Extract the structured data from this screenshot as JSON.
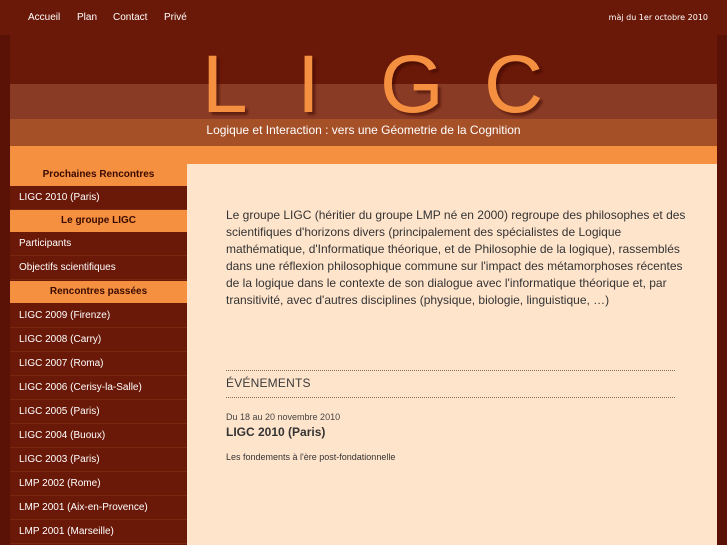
{
  "topnav": {
    "links": [
      "Accueil",
      "Plan",
      "Contact",
      "Privé"
    ],
    "updated": "màj du 1er octobre 2010"
  },
  "banner": {
    "logo_letters": [
      "L",
      "I",
      "G",
      "C"
    ],
    "tagline": "Logique et Interaction : vers une Géometrie de la Cognition"
  },
  "sidebar": {
    "sections": [
      {
        "heading": "Prochaines Rencontres",
        "items": [
          "LIGC 2010 (Paris)"
        ]
      },
      {
        "heading": "Le groupe LIGC",
        "items": [
          "Participants",
          "Objectifs scientifiques"
        ]
      },
      {
        "heading": "Rencontres passées",
        "items": [
          "LIGC 2009 (Firenze)",
          "LIGC 2008 (Carry)",
          "LIGC 2007 (Roma)",
          "LIGC 2006 (Cerisy-la-Salle)",
          "LIGC 2005 (Paris)",
          "LIGC 2004 (Buoux)",
          "LIGC 2003 (Paris)",
          "LMP 2002 (Rome)",
          "LMP 2001 (Aix-en-Provence)",
          "LMP 2001 (Marseille)"
        ]
      }
    ]
  },
  "main": {
    "intro": "Le groupe LIGC (héritier du groupe LMP né en 2000) regroupe des philosophes et des scientifiques d'horizons divers (principalement des spécialistes de Logique mathématique, d'Informatique théorique, et de Philosophie de la logique), rassemblés dans une réflexion philosophique commune sur l'impact des métamorphoses récentes de la logique dans le contexte de son dialogue avec l'informatique théorique et, par transitivité, avec d'autres disciplines (physique, biologie, linguistique, …)",
    "events_heading": "ÉVÉNEMENTS",
    "event": {
      "date": "Du 18 au 20 novembre 2010",
      "title": "LIGC 2010 (Paris)",
      "description": "Les fondements à l'ère post-fondationnelle"
    }
  }
}
